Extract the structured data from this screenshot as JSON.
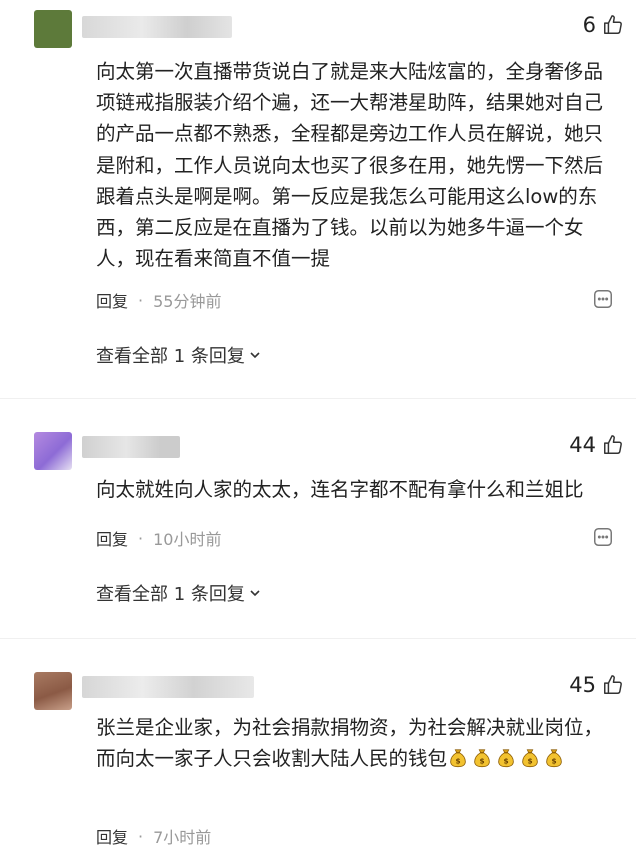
{
  "comments": [
    {
      "likes": "6",
      "text": "向太第一次直播带货说白了就是来大陆炫富的，全身奢侈品项链戒指服装介绍个遍，还一大帮港星助阵，结果她对自己的产品一点都不熟悉，全程都是旁边工作人员在解说，她只是附和，工作人员说向太也买了很多在用，她先愣一下然后跟着点头是啊是啊。第一反应是我怎么可能用这么low的东西，第二反应是在直播为了钱。以前以为她多牛逼一个女人，现在看来简直不值一提",
      "reply": "回复",
      "dot": "·",
      "time": "55分钟前",
      "view_replies": "查看全部 1 条回复"
    },
    {
      "likes": "44",
      "text": "向太就姓向人家的太太，连名字都不配有拿什么和兰姐比",
      "reply": "回复",
      "dot": "·",
      "time": "10小时前",
      "view_replies": "查看全部 1 条回复"
    },
    {
      "likes": "45",
      "text": "张兰是企业家，为社会捐款捐物资，为社会解决就业岗位，而向太一家子人只会收割大陆人民的钱包",
      "emoji": "money-bag",
      "emoji_count": 5,
      "reply": "回复",
      "dot": "·",
      "time": "7小时前"
    }
  ]
}
